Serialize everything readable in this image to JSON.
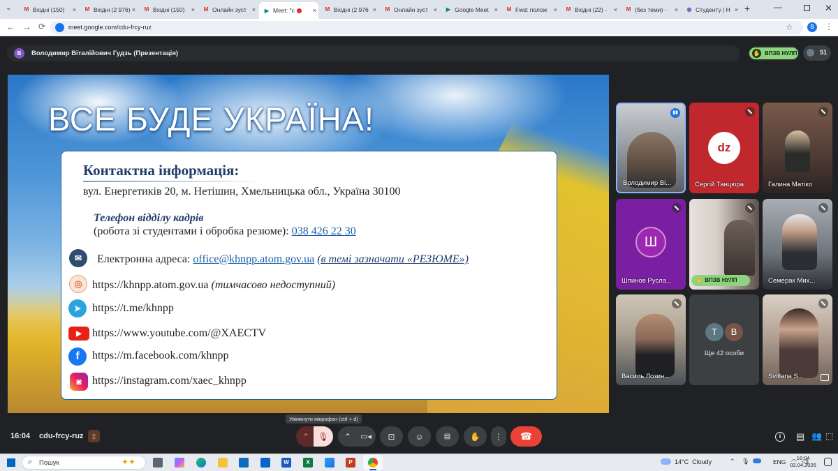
{
  "tabs": [
    {
      "label": "Вхідні (150)",
      "icon": "gmail-icon",
      "active": false
    },
    {
      "label": "Вхідні (2 976)",
      "icon": "gmail-icon",
      "active": false
    },
    {
      "label": "Вхідні (150)",
      "icon": "gmail-icon",
      "active": false
    },
    {
      "label": "Онлайн зуст",
      "icon": "gmail-icon",
      "active": false
    },
    {
      "label": "Meet: \"c",
      "icon": "meet-icon",
      "active": true
    },
    {
      "label": "Вхідні (2 976",
      "icon": "gmail-icon",
      "active": false
    },
    {
      "label": "Онлайн зуст",
      "icon": "gmail-icon",
      "active": false
    },
    {
      "label": "Google Meet",
      "icon": "meet-icon",
      "active": false
    },
    {
      "label": "Fwd: полож",
      "icon": "gmail-icon",
      "active": false
    },
    {
      "label": "Вхідні (22) -",
      "icon": "gmail-icon",
      "active": false
    },
    {
      "label": "(без теми) -",
      "icon": "gmail-icon",
      "active": false
    },
    {
      "label": "Студенту | Н",
      "icon": "globe-icon",
      "active": false
    }
  ],
  "browser": {
    "url": "meet.google.com/cdu-frcy-ruz",
    "profile_initial": "S",
    "new_tab": "+"
  },
  "meet": {
    "presenter_initial": "В",
    "presenter_label": "Володимир Віталійович Гудзь (Презентація)",
    "hand_badge": "ВПЗВ НУЛП",
    "participants_count": "51",
    "tooltip": "Увімкнути мікрофон (ctrl + d)",
    "time": "16:04",
    "meeting_code": "cdu-frcy-ruz"
  },
  "slide": {
    "title": "ВСЕ БУДЕ УКРАЇНА!",
    "heading": "Контактна інформація:",
    "address": "вул. Енергетиків 20, м. Нетішин, Хмельницька обл., Україна 30100",
    "hr_title": "Телефон відділу кадрів",
    "hr_desc": "(робота зі студентами і обробка резюме):",
    "hr_phone": "038 426 22 30",
    "email_label": "Електронна адреса:",
    "email": "office@khnpp.atom.gov.ua",
    "email_note": "(в темі зазначати «РЕЗЮМЕ»)",
    "site": "https://khnpp.atom.gov.ua",
    "site_note": "(тимчасово недоступний)",
    "telegram": "https://t.me/khnpp",
    "youtube": "https://www.youtube.com/@XAECTV",
    "facebook": "https://m.facebook.com/khnpp",
    "instagram": "https://instagram.com/xaec_khnpp"
  },
  "participants": [
    {
      "name": "Володимир Ві...",
      "kind": "video"
    },
    {
      "name": "Сергій Танцюра",
      "kind": "logo"
    },
    {
      "name": "Галина Матіко",
      "kind": "video"
    },
    {
      "name": "Шпинов Русла...",
      "kind": "avatar",
      "initial": "Ш"
    },
    {
      "name": "ВПЗВ НУЛП",
      "kind": "video"
    },
    {
      "name": "Семерак Мих...",
      "kind": "video"
    },
    {
      "name": "Василь Лозин...",
      "kind": "video"
    },
    {
      "name": "Ще 42 особи",
      "kind": "more",
      "initials": [
        "Т",
        "В"
      ]
    },
    {
      "name": "Svitlana S...",
      "kind": "video"
    }
  ],
  "taskbar": {
    "search_placeholder": "Пошук",
    "weather": "14°C  Cloudy",
    "lang": "ENG",
    "clock_time": "16:04",
    "clock_date": "02.04.2026"
  },
  "colors": {
    "end_call": "#ea4335",
    "meet_bg": "#202124",
    "hand_green": "#8ed37f",
    "avatar_purple": "#7b1fa2"
  }
}
